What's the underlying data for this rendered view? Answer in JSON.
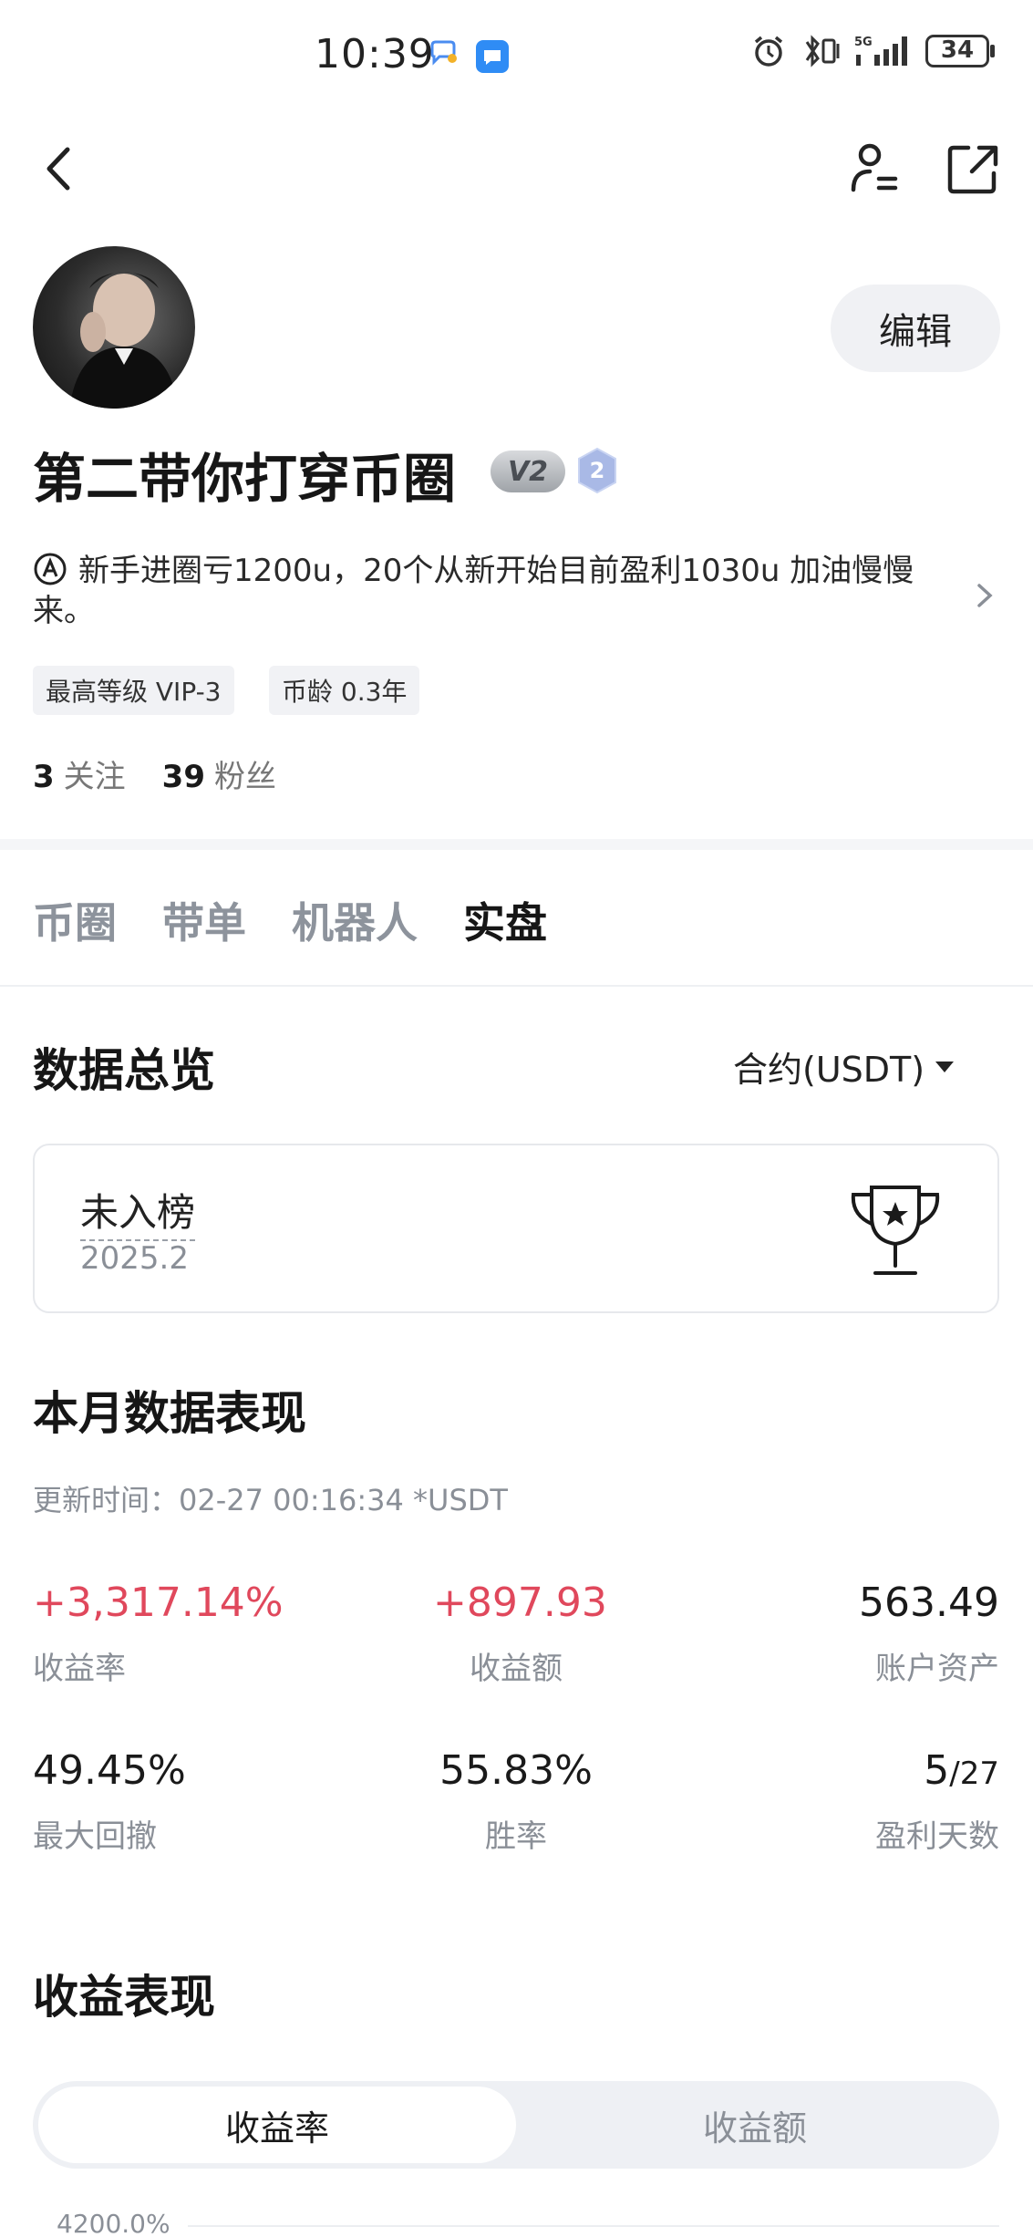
{
  "status_bar": {
    "time": "10:39",
    "battery": "34"
  },
  "profile": {
    "edit_label": "编辑",
    "username": "第二带你打穿币圈",
    "vip_badge": "V2",
    "level_badge": "2",
    "bio": "新手进圈亏1200u，20个从新开始目前盈利1030u 加油慢慢来。",
    "tags": [
      "最高等级 VIP-3",
      "币龄 0.3年"
    ],
    "following_count": "3",
    "following_label": "关注",
    "followers_count": "39",
    "followers_label": "粉丝"
  },
  "tabs": [
    {
      "label": "币圈",
      "active": false
    },
    {
      "label": "带单",
      "active": false
    },
    {
      "label": "机器人",
      "active": false
    },
    {
      "label": "实盘",
      "active": true
    }
  ],
  "overview": {
    "title": "数据总览",
    "contract_select": "合约(USDT)",
    "rank_status": "未入榜",
    "rank_period": "2025.2"
  },
  "monthly": {
    "title": "本月数据表现",
    "update_time": "更新时间：02-27 00:16:34  *USDT",
    "stats": [
      {
        "value": "+3,317.14%",
        "label": "收益率"
      },
      {
        "value": "+897.93",
        "label": "收益额"
      },
      {
        "value": "563.49",
        "label": "账户资产"
      },
      {
        "value": "49.45%",
        "label": "最大回撤"
      },
      {
        "value": "55.83%",
        "label": "胜率"
      },
      {
        "value": "5",
        "value_suffix": "/27",
        "label": "盈利天数"
      }
    ]
  },
  "earnings": {
    "title": "收益表现",
    "seg_active": "收益率",
    "seg_inactive": "收益额",
    "axis_top": "4200.0%"
  },
  "colors": {
    "positive": "#e0485c",
    "accent_gray": "#8a8f97"
  }
}
